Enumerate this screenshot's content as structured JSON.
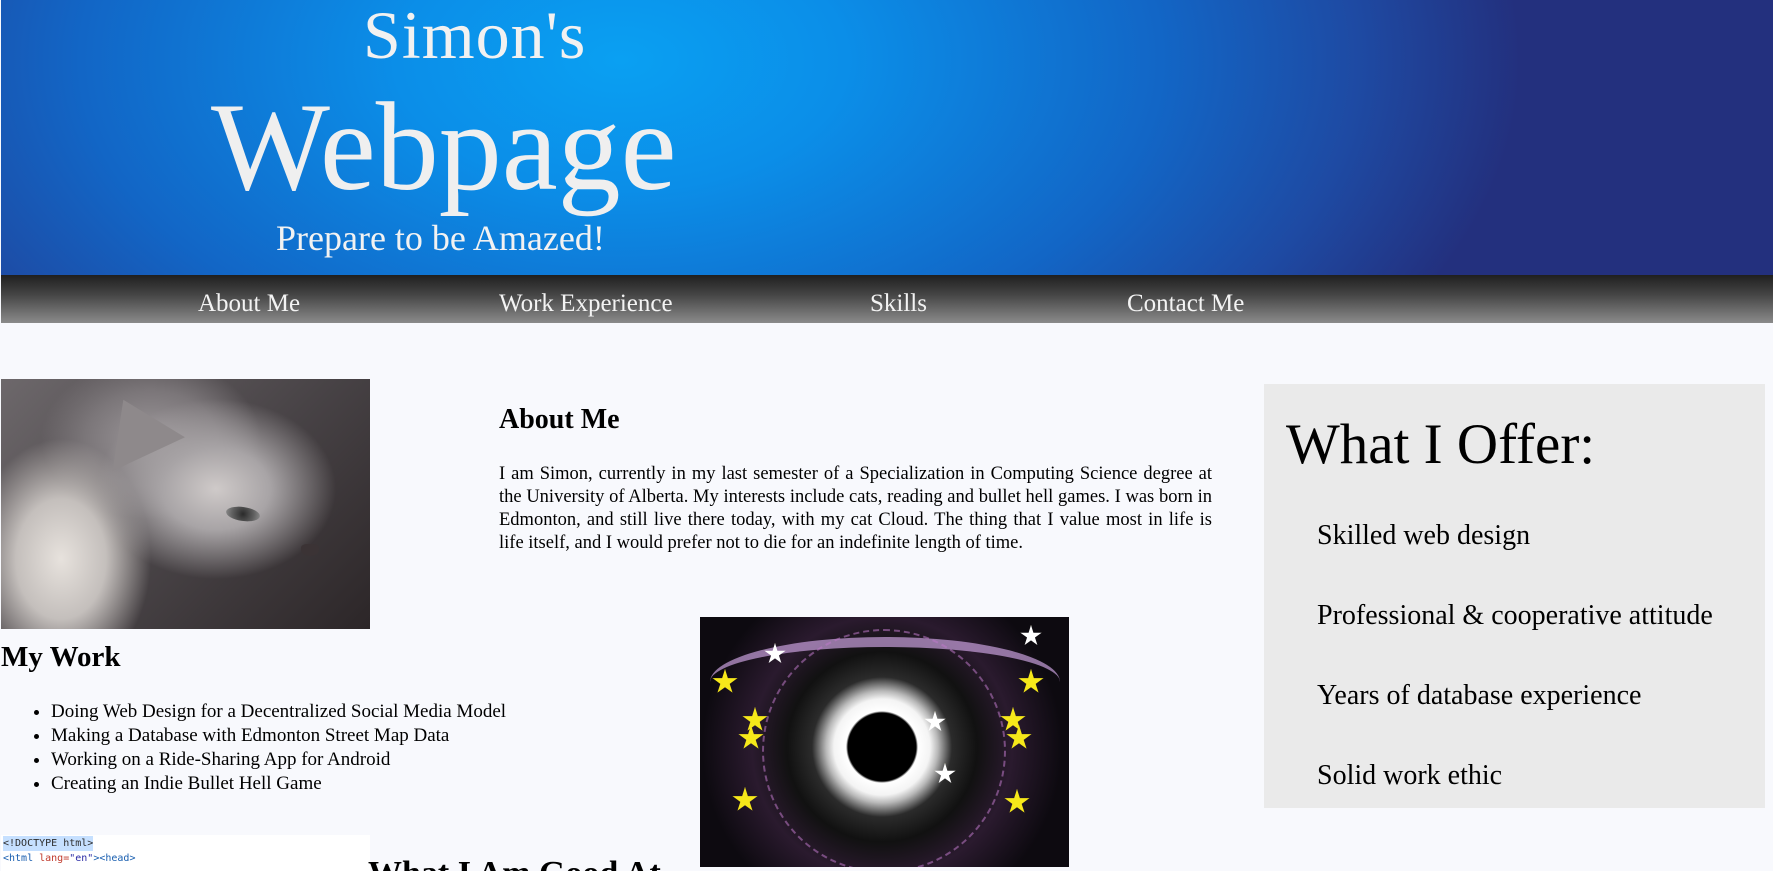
{
  "header": {
    "title_top": "Simon's",
    "title_main": "Webpage",
    "tagline": "Prepare to be Amazed!"
  },
  "nav": {
    "items": [
      "About Me",
      "Work Experience",
      "Skills",
      "Contact Me"
    ]
  },
  "my_work": {
    "title": "My Work",
    "items": [
      "Doing Web Design for a Decentralized Social Media Model",
      "Making a Database with Edmonton Street Map Data",
      "Working on a Ride-Sharing App for Android",
      "Creating an Indie Bullet Hell Game"
    ]
  },
  "about": {
    "title": "About Me",
    "text": "I am Simon, currently in my last semester of a Specialization in Computing Science degree at the University of Alberta. My interests include cats, reading and bullet hell games. I was born in Edmonton, and still live there today, with my cat Cloud. The thing that I value most in life is life itself, and I would prefer not to die for an indefinite length of time."
  },
  "offer": {
    "title": "What I Offer:",
    "items": [
      "Skilled web design",
      "Professional & cooperative attitude",
      "Years of database experience",
      "Solid work ethic"
    ]
  },
  "code": {
    "line1": "<!DOCTYPE html>",
    "line2_tag": "<html ",
    "line2_attr": "lang=",
    "line2_val": "\"en\"",
    "line2_rest": "><head>"
  },
  "cut_heading": "What I Am Good At"
}
